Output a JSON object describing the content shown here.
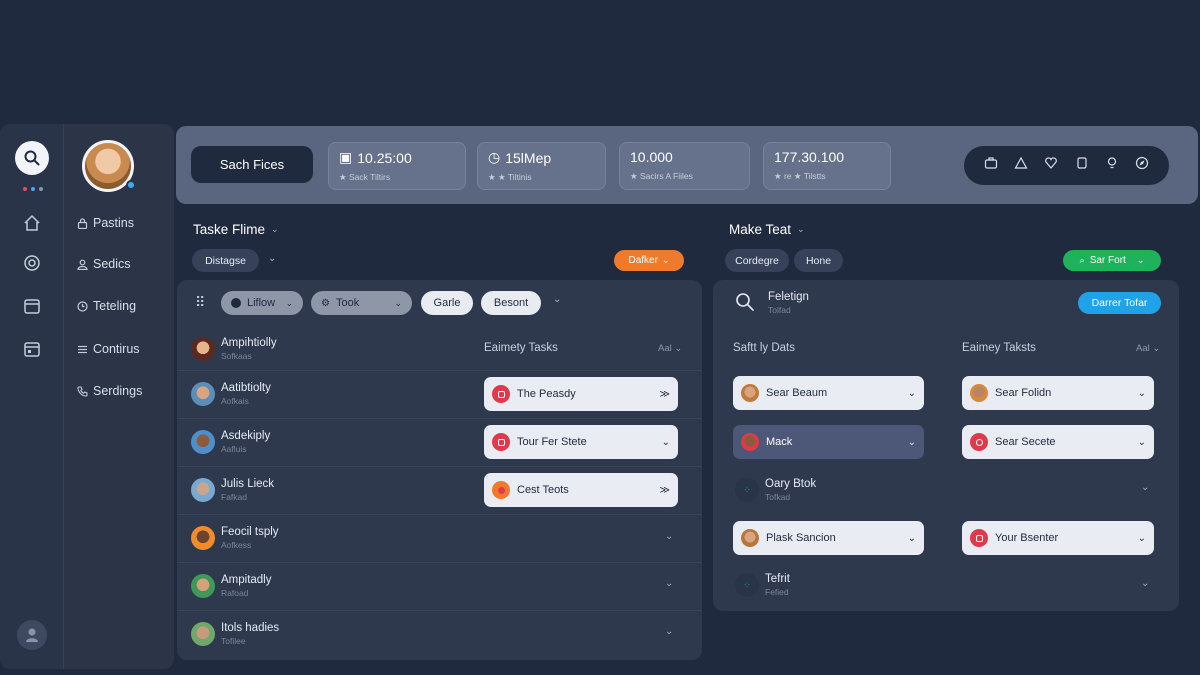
{
  "rail": {
    "dot_colors": [
      "#e84a5f",
      "#3fa9f5",
      "#8b93a6"
    ]
  },
  "nav": {
    "items": [
      {
        "label": "Pastins",
        "icon": "lock-icon"
      },
      {
        "label": "Sedics",
        "icon": "user-icon"
      },
      {
        "label": "Teteling",
        "icon": "clock-icon"
      },
      {
        "label": "Contirus",
        "icon": "menu-icon"
      },
      {
        "label": "Serdings",
        "icon": "phone-icon"
      }
    ]
  },
  "topbar": {
    "button_label": "Sach Fices",
    "stats": [
      {
        "value": "10.25:00",
        "sub": "★ Sack Tiltirs",
        "icon": "calendar-icon"
      },
      {
        "value": "15lMep",
        "sub": "★ ★ Tiltinis",
        "icon": "clock-icon"
      },
      {
        "value": "10.000",
        "sub": "★ Sacirs A Fiiles",
        "icon": ""
      },
      {
        "value": "177.30.100",
        "sub": "★ re ★ Tilstts",
        "icon": ""
      }
    ]
  },
  "left_panel": {
    "title": "Taske Flime",
    "sort_label": "Distagse",
    "action_label": "Dafker",
    "filters": [
      "Liflow",
      "Took",
      "Garle",
      "Besont"
    ],
    "col_tasks": "Eaimety Tasks",
    "all_label": "Aal",
    "people": [
      {
        "name": "Ampihtiolly",
        "sub": "Sofkaas"
      },
      {
        "name": "Aatibtiolty",
        "sub": "Aofkais"
      },
      {
        "name": "Asdekiply",
        "sub": "Aafluis"
      },
      {
        "name": "Julis Lieck",
        "sub": "Fafkad"
      },
      {
        "name": "Feocil tsply",
        "sub": "Aofkess"
      },
      {
        "name": "Ampitadly",
        "sub": "Rafoad"
      },
      {
        "name": "Itols hadies",
        "sub": "Tofilee"
      }
    ],
    "tasks": [
      {
        "label": "The Peasdy",
        "end": "≫",
        "color": "#e03a4a"
      },
      {
        "label": "Tour Fer Stete",
        "end": "⌄",
        "color": "#e03a4a"
      },
      {
        "label": "Cest Teots",
        "end": "≫",
        "color": "#f07a2c"
      }
    ]
  },
  "right_panel": {
    "title": "Make Teat",
    "filters": [
      "Cordegre",
      "Hone"
    ],
    "action_label": "Sar Fort",
    "search_title": "Feletign",
    "search_sub": "Tolfad",
    "search_button": "Darrer Tofar",
    "col_one": "Saftt ly Dats",
    "col_two": "Eaimey Taksts",
    "all_label": "Aal",
    "rows": [
      {
        "left": {
          "label": "Sear Beaum",
          "style": "light"
        },
        "right": {
          "label": "Sear Folidn",
          "style": "light"
        }
      },
      {
        "left": {
          "label": "Mack",
          "style": "dark"
        },
        "right": {
          "label": "Sear Secete",
          "style": "light"
        }
      },
      {
        "person": {
          "name": "Oary Btok",
          "sub": "Tofkad"
        }
      },
      {
        "left": {
          "label": "Plask Sancion",
          "style": "light"
        },
        "right": {
          "label": "Your Bsenter",
          "style": "light"
        }
      },
      {
        "person": {
          "name": "Tefrit",
          "sub": "Fefied"
        }
      }
    ]
  }
}
